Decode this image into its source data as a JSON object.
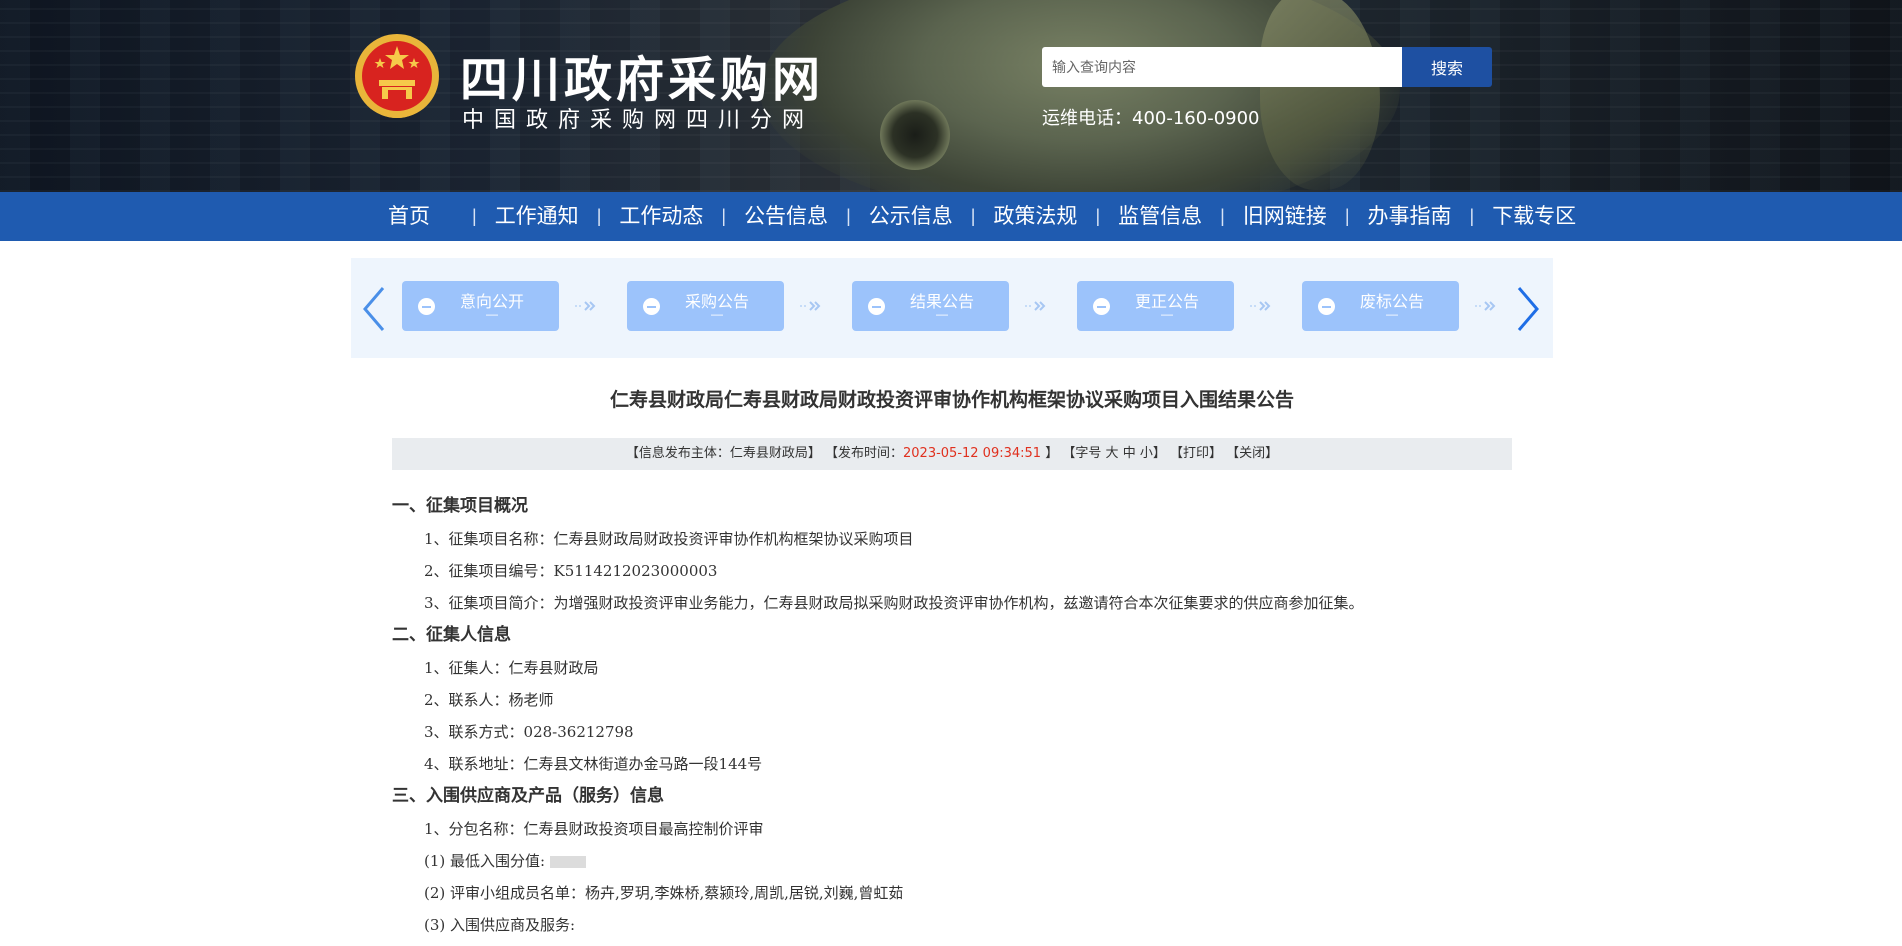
{
  "header": {
    "site_title": "四川政府采购网",
    "site_subtitle": "中国政府采购网四川分网",
    "search_placeholder": "输入查询内容",
    "search_button": "搜索",
    "hotline": "运维电话：400-160-0900"
  },
  "nav": {
    "items": [
      "首页",
      "工作通知",
      "工作动态",
      "公告信息",
      "公示信息",
      "政策法规",
      "监管信息",
      "旧网链接",
      "办事指南",
      "下载专区"
    ],
    "separator": "|"
  },
  "steps": {
    "items": [
      {
        "label": "意向公开",
        "sub": "—"
      },
      {
        "label": "采购公告",
        "sub": "—"
      },
      {
        "label": "结果公告",
        "sub": "—"
      },
      {
        "label": "更正公告",
        "sub": "—"
      },
      {
        "label": "废标公告",
        "sub": "—"
      }
    ]
  },
  "article": {
    "title": "仁寿县财政局仁寿县财政局财政投资评审协作机构框架协议采购项目入围结果公告",
    "meta": {
      "publisher": "【信息发布主体：仁寿县财政局】",
      "time_label": "【发布时间：",
      "time_value": "2023-05-12 09:34:51",
      "time_close": "】",
      "font_size": "【字号",
      "font_large": "大",
      "font_medium": "中",
      "font_small": "小】",
      "print": "【打印】",
      "close": "【关闭】"
    },
    "sections": [
      {
        "heading": "一、征集项目概况",
        "rows": [
          "1、征集项目名称：仁寿县财政局财政投资评审协作机构框架协议采购项目",
          "2、征集项目编号：K5114212023000003",
          "3、征集项目简介：为增强财政投资评审业务能力，仁寿县财政局拟采购财政投资评审协作机构，兹邀请符合本次征集要求的供应商参加征集。"
        ]
      },
      {
        "heading": "二、征集人信息",
        "rows": [
          "1、征集人：仁寿县财政局",
          "2、联系人：杨老师",
          "3、联系方式：028-36212798",
          "4、联系地址：仁寿县文林街道办金马路一段144号"
        ]
      },
      {
        "heading": "三、入围供应商及产品（服务）信息",
        "rows": [
          "1、分包名称：仁寿县财政投资项目最高控制价评审",
          "(1) 最低入围分值:",
          "(2) 评审小组成员名单：杨卉,罗玥,李姝桥,蔡颍玲,周凯,居锐,刘巍,曾虹茹",
          "(3) 入围供应商及服务:"
        ]
      }
    ]
  },
  "colors": {
    "nav_bg": "#1f5bb0",
    "search_btn": "#1e50a2",
    "step_bg": "#9cc3fb",
    "panel_bg": "#eef5fd",
    "time_red": "#e0301e"
  }
}
